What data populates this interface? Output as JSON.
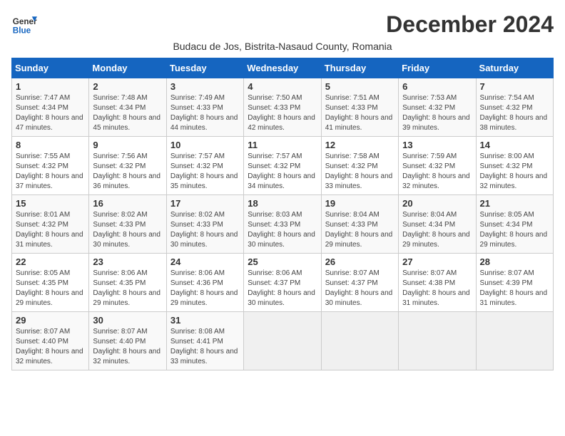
{
  "logo": {
    "general": "General",
    "blue": "Blue"
  },
  "title": "December 2024",
  "subtitle": "Budacu de Jos, Bistrita-Nasaud County, Romania",
  "days_of_week": [
    "Sunday",
    "Monday",
    "Tuesday",
    "Wednesday",
    "Thursday",
    "Friday",
    "Saturday"
  ],
  "weeks": [
    [
      {
        "day": "1",
        "sunrise": "7:47 AM",
        "sunset": "4:34 PM",
        "daylight": "8 hours and 47 minutes."
      },
      {
        "day": "2",
        "sunrise": "7:48 AM",
        "sunset": "4:34 PM",
        "daylight": "8 hours and 45 minutes."
      },
      {
        "day": "3",
        "sunrise": "7:49 AM",
        "sunset": "4:33 PM",
        "daylight": "8 hours and 44 minutes."
      },
      {
        "day": "4",
        "sunrise": "7:50 AM",
        "sunset": "4:33 PM",
        "daylight": "8 hours and 42 minutes."
      },
      {
        "day": "5",
        "sunrise": "7:51 AM",
        "sunset": "4:33 PM",
        "daylight": "8 hours and 41 minutes."
      },
      {
        "day": "6",
        "sunrise": "7:53 AM",
        "sunset": "4:32 PM",
        "daylight": "8 hours and 39 minutes."
      },
      {
        "day": "7",
        "sunrise": "7:54 AM",
        "sunset": "4:32 PM",
        "daylight": "8 hours and 38 minutes."
      }
    ],
    [
      {
        "day": "8",
        "sunrise": "7:55 AM",
        "sunset": "4:32 PM",
        "daylight": "8 hours and 37 minutes."
      },
      {
        "day": "9",
        "sunrise": "7:56 AM",
        "sunset": "4:32 PM",
        "daylight": "8 hours and 36 minutes."
      },
      {
        "day": "10",
        "sunrise": "7:57 AM",
        "sunset": "4:32 PM",
        "daylight": "8 hours and 35 minutes."
      },
      {
        "day": "11",
        "sunrise": "7:57 AM",
        "sunset": "4:32 PM",
        "daylight": "8 hours and 34 minutes."
      },
      {
        "day": "12",
        "sunrise": "7:58 AM",
        "sunset": "4:32 PM",
        "daylight": "8 hours and 33 minutes."
      },
      {
        "day": "13",
        "sunrise": "7:59 AM",
        "sunset": "4:32 PM",
        "daylight": "8 hours and 32 minutes."
      },
      {
        "day": "14",
        "sunrise": "8:00 AM",
        "sunset": "4:32 PM",
        "daylight": "8 hours and 32 minutes."
      }
    ],
    [
      {
        "day": "15",
        "sunrise": "8:01 AM",
        "sunset": "4:32 PM",
        "daylight": "8 hours and 31 minutes."
      },
      {
        "day": "16",
        "sunrise": "8:02 AM",
        "sunset": "4:33 PM",
        "daylight": "8 hours and 30 minutes."
      },
      {
        "day": "17",
        "sunrise": "8:02 AM",
        "sunset": "4:33 PM",
        "daylight": "8 hours and 30 minutes."
      },
      {
        "day": "18",
        "sunrise": "8:03 AM",
        "sunset": "4:33 PM",
        "daylight": "8 hours and 30 minutes."
      },
      {
        "day": "19",
        "sunrise": "8:04 AM",
        "sunset": "4:33 PM",
        "daylight": "8 hours and 29 minutes."
      },
      {
        "day": "20",
        "sunrise": "8:04 AM",
        "sunset": "4:34 PM",
        "daylight": "8 hours and 29 minutes."
      },
      {
        "day": "21",
        "sunrise": "8:05 AM",
        "sunset": "4:34 PM",
        "daylight": "8 hours and 29 minutes."
      }
    ],
    [
      {
        "day": "22",
        "sunrise": "8:05 AM",
        "sunset": "4:35 PM",
        "daylight": "8 hours and 29 minutes."
      },
      {
        "day": "23",
        "sunrise": "8:06 AM",
        "sunset": "4:35 PM",
        "daylight": "8 hours and 29 minutes."
      },
      {
        "day": "24",
        "sunrise": "8:06 AM",
        "sunset": "4:36 PM",
        "daylight": "8 hours and 29 minutes."
      },
      {
        "day": "25",
        "sunrise": "8:06 AM",
        "sunset": "4:37 PM",
        "daylight": "8 hours and 30 minutes."
      },
      {
        "day": "26",
        "sunrise": "8:07 AM",
        "sunset": "4:37 PM",
        "daylight": "8 hours and 30 minutes."
      },
      {
        "day": "27",
        "sunrise": "8:07 AM",
        "sunset": "4:38 PM",
        "daylight": "8 hours and 31 minutes."
      },
      {
        "day": "28",
        "sunrise": "8:07 AM",
        "sunset": "4:39 PM",
        "daylight": "8 hours and 31 minutes."
      }
    ],
    [
      {
        "day": "29",
        "sunrise": "8:07 AM",
        "sunset": "4:40 PM",
        "daylight": "8 hours and 32 minutes."
      },
      {
        "day": "30",
        "sunrise": "8:07 AM",
        "sunset": "4:40 PM",
        "daylight": "8 hours and 32 minutes."
      },
      {
        "day": "31",
        "sunrise": "8:08 AM",
        "sunset": "4:41 PM",
        "daylight": "8 hours and 33 minutes."
      },
      null,
      null,
      null,
      null
    ]
  ]
}
